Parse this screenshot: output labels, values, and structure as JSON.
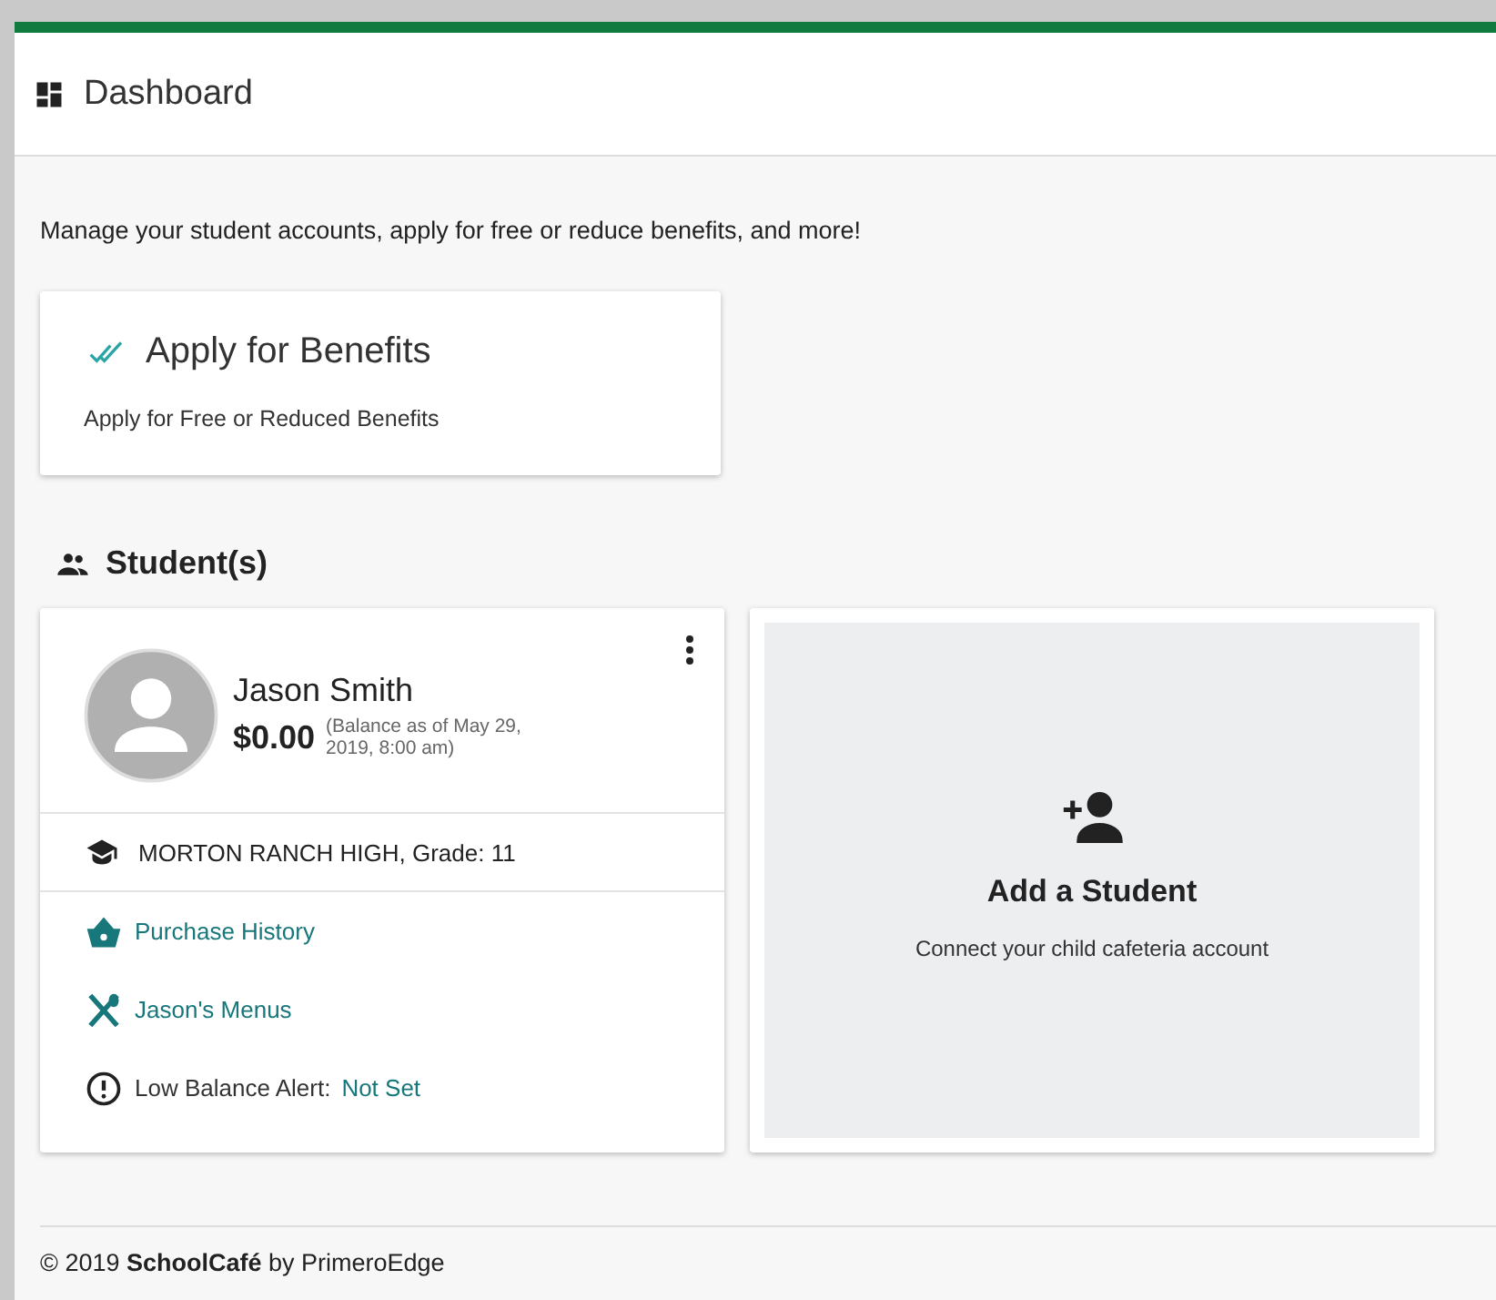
{
  "header": {
    "title": "Dashboard"
  },
  "intro": "Manage your student accounts, apply for free or reduce benefits, and more!",
  "benefits_card": {
    "title": "Apply for Benefits",
    "subtitle": "Apply for Free or Reduced Benefits"
  },
  "students_section": {
    "title": "Student(s)"
  },
  "students": [
    {
      "name": "Jason Smith",
      "balance": "$0.00",
      "balance_note": "(Balance as of May 29, 2019, 8:00 am)",
      "school": "MORTON RANCH HIGH, Grade: 11",
      "rows": [
        {
          "kind": "purchase",
          "label": "Purchase History"
        },
        {
          "kind": "menus",
          "label": "Jason's Menus"
        },
        {
          "kind": "alert",
          "label": "Low Balance Alert:",
          "value": "Not Set"
        }
      ]
    }
  ],
  "add_card": {
    "title": "Add a Student",
    "subtitle": "Connect your child cafeteria account"
  },
  "footer": {
    "text": "© 2019 **SchoolCafé** by PrimeroEdge"
  }
}
